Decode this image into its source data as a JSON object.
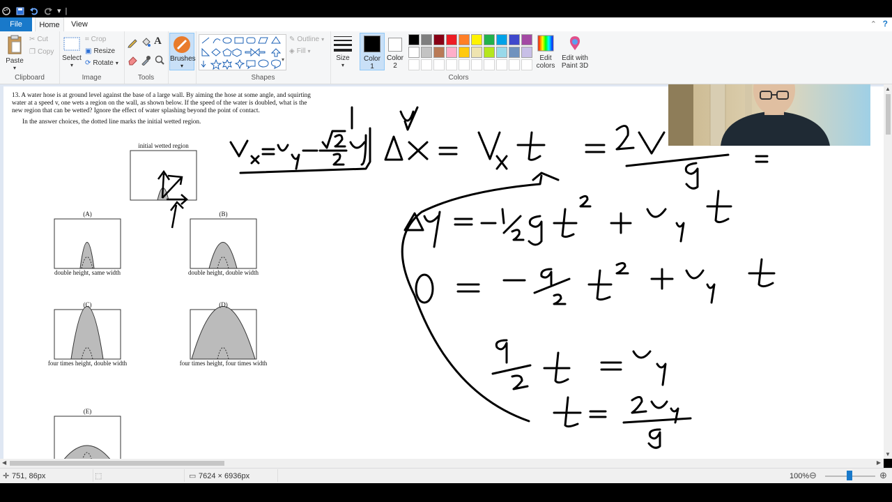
{
  "tabs": {
    "file": "File",
    "home": "Home",
    "view": "View"
  },
  "ribbon": {
    "clipboard": {
      "paste": "Paste",
      "cut": "Cut",
      "copy": "Copy",
      "label": "Clipboard"
    },
    "image": {
      "select": "Select",
      "crop": "Crop",
      "resize": "Resize",
      "rotate": "Rotate",
      "label": "Image"
    },
    "tools": {
      "label": "Tools"
    },
    "brushes": {
      "label": "Brushes"
    },
    "shapes": {
      "outline": "Outline",
      "fill": "Fill",
      "label": "Shapes"
    },
    "size": {
      "label": "Size"
    },
    "color1": {
      "line1": "Color",
      "line2": "1"
    },
    "color2": {
      "line1": "Color",
      "line2": "2"
    },
    "colors": {
      "label": "Colors"
    },
    "edit_colors": {
      "line1": "Edit",
      "line2": "colors"
    },
    "paint3d": {
      "line1": "Edit with",
      "line2": "Paint 3D"
    }
  },
  "palette": {
    "row1": [
      "#000000",
      "#7f7f7f",
      "#880015",
      "#ed1c24",
      "#ff7f27",
      "#fff200",
      "#22b14c",
      "#00a2e8",
      "#3f48cc",
      "#a349a4"
    ],
    "row2": [
      "#ffffff",
      "#c3c3c3",
      "#b97a57",
      "#ffaec9",
      "#ffc90e",
      "#efe4b0",
      "#b5e61d",
      "#99d9ea",
      "#7092be",
      "#c8bfe7"
    ],
    "color1": "#000000",
    "color2": "#ffffff"
  },
  "problem": {
    "text": "13. A water hose is at ground level against the base of a large wall. By aiming the hose at some angle, and squirting water at a speed v, one wets a region on the wall, as shown below. If the speed of the water is doubled, what is the new region that can be wetted? Ignore the effect of water splashing beyond the point of contact.",
    "note": "In the answer choices, the dotted line marks the initial wetted region.",
    "initial_label": "initial wetted region",
    "choices": [
      {
        "letter": "(A)",
        "caption": "double height, same width"
      },
      {
        "letter": "(B)",
        "caption": "double height, double width"
      },
      {
        "letter": "(C)",
        "caption": "four times height, double width"
      },
      {
        "letter": "(D)",
        "caption": "four times height, four times width"
      },
      {
        "letter": "(E)",
        "caption": ""
      }
    ]
  },
  "status": {
    "cursor": "751, 86px",
    "canvas_size": "7624 × 6936px",
    "zoom": "100%"
  }
}
